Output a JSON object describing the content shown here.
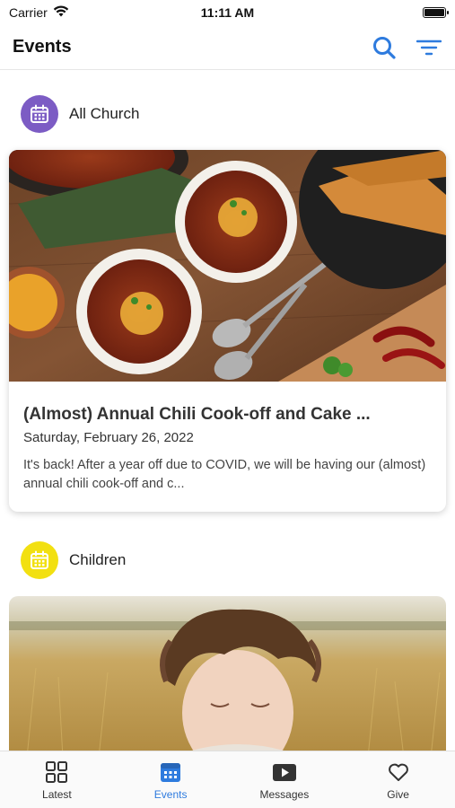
{
  "status": {
    "carrier": "Carrier",
    "time": "11:11 AM"
  },
  "nav": {
    "title": "Events",
    "search_icon": "search-icon",
    "filter_icon": "filter-icon"
  },
  "sections": [
    {
      "label": "All Church",
      "icon": "calendar-icon",
      "icon_color": "#7c5cc4",
      "event": {
        "title": "(Almost) Annual Chili Cook-off and Cake ...",
        "date": "Saturday, February 26, 2022",
        "description": "It's back! After a year off due to COVID, we will be having our (almost) annual chili cook-off and c..."
      }
    },
    {
      "label": "Children",
      "icon": "calendar-icon",
      "icon_color": "#f2e011"
    }
  ],
  "tabs": [
    {
      "label": "Latest",
      "icon": "grid-icon",
      "active": false
    },
    {
      "label": "Events",
      "icon": "calendar-icon",
      "active": true
    },
    {
      "label": "Messages",
      "icon": "play-icon",
      "active": false
    },
    {
      "label": "Give",
      "icon": "heart-icon",
      "active": false
    }
  ],
  "colors": {
    "accent": "#2e7bde",
    "all_church": "#7c5cc4",
    "children": "#f2e011"
  }
}
